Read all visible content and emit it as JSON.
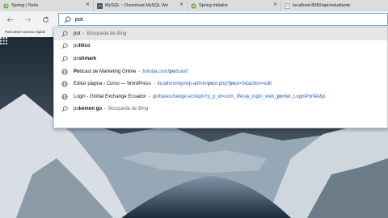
{
  "tabs": [
    {
      "label": "Spring | Tools",
      "favicon": "spring-leaf-icon",
      "active": false
    },
    {
      "label": "MySQL :: Download MySQL Wo",
      "favicon": "mysql-icon",
      "active": false
    },
    {
      "label": "Spring Initializr",
      "favicon": "spring-leaf-icon",
      "active": false
    },
    {
      "label": "localhost:8080/api/estudiante",
      "favicon": "page-icon",
      "active": false
    }
  ],
  "address_bar": {
    "value": "pot"
  },
  "favorites_bar": {
    "hint": "Para tener acceso rápido"
  },
  "suggestions": [
    {
      "kind": "search",
      "icon": "search-icon",
      "parts": {
        "main": "pot",
        "sep": "-",
        "sub": "Búsqueda de Bing"
      }
    },
    {
      "kind": "search",
      "icon": "search-icon",
      "parts": {
        "pre": "po",
        "bold": "lítico"
      }
    },
    {
      "kind": "search",
      "icon": "search-icon",
      "parts": {
        "pre": "po",
        "bold": "shmark"
      }
    },
    {
      "kind": "site",
      "icon": "globe-icon",
      "parts": {
        "bold1": "Po",
        "title": "dcast de Marketing Online",
        "sep": "-",
        "url_pre": "boluda.com/",
        "url_bold": "po",
        "url_post": "dcast/"
      }
    },
    {
      "kind": "site",
      "icon": "globe-icon",
      "parts": {
        "title": "Editar página ‹ Curso — WordPress",
        "sep": "-",
        "url_pre": "localhost/wp/wp-admin/",
        "url_bold": "po",
        "url_mid": "st.php?",
        "url_bold2": "po",
        "url_post": "st=5&action=edit"
      }
    },
    {
      "kind": "site",
      "icon": "globe-icon",
      "parts": {
        "title": "Login - Global Exchange Ecuador",
        "sep": "-",
        "url_pre": "globalexchange.ec/login?p_p_id=com_liferay_login_web_",
        "url_bold": "po",
        "url_post": "rtlet_LoginPortlet&p"
      }
    },
    {
      "kind": "search",
      "icon": "search-icon",
      "parts": {
        "pre": "po",
        "bold": "kemon go",
        "sep": "-",
        "sub": "Búsqueda de Bing"
      }
    }
  ],
  "colors": {
    "accent": "#2a64c0",
    "tab_strip": "#dcdcdc",
    "toolbar": "#f2f2f2"
  }
}
